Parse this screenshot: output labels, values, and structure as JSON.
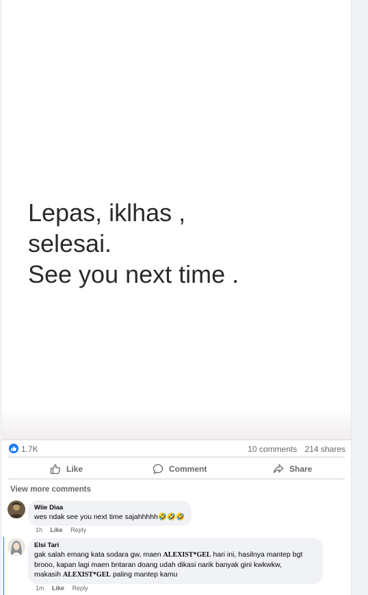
{
  "post": {
    "caption_lines": [
      "Lepas, iklhas ,",
      "selesai.",
      "See you next time ."
    ],
    "reactions_count": "1.7K",
    "comments_count": "10 comments",
    "shares_count": "214 shares"
  },
  "actions": {
    "like": "Like",
    "comment": "Comment",
    "share": "Share"
  },
  "view_more": "View more comments",
  "comments": [
    {
      "name": "Wiie Diaa",
      "text": "wes ndak see you next time sajahhhhh🤣🤣🤣",
      "time": "1h",
      "like": "Like",
      "reply": "Reply"
    },
    {
      "name": "Elsi Tari",
      "line1_a": "gak salah emang kata sodara gw, maen ",
      "brand": "ALEXIST*GEL",
      "line1_b": " hari ini, hasilnya mantep bgt",
      "line2": "brooo, kapan lagi maen bntaran doang udah dikasi narik banyak gini kwkwkw,",
      "line3_a": "makasih ",
      "line3_b": " paling mantep kamu",
      "time": "1m",
      "like": "Like",
      "reply": "Reply"
    }
  ],
  "colors": {
    "accent": "#1877f2",
    "muted": "#65676b",
    "bubble": "#f0f2f5"
  }
}
